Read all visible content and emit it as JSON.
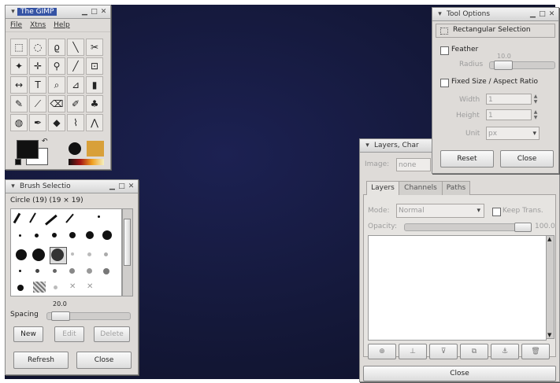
{
  "toolbox": {
    "title": "The GIMP",
    "menu": [
      "File",
      "Xtns",
      "Help"
    ],
    "tools": [
      "rect-select-icon",
      "ellipse-select-icon",
      "lasso-icon",
      "magic-wand-icon",
      "scissors-icon",
      "fuzzy-select-icon",
      "move-icon",
      "zoom-icon",
      "pencil-line-icon",
      "crop-icon",
      "flip-icon",
      "text-icon",
      "color-picker-icon",
      "bucket-fill-icon",
      "blend-icon",
      "pencil-icon",
      "paintbrush-icon",
      "eraser-icon",
      "airbrush-icon",
      "clone-icon",
      "smudge-icon",
      "dodge-icon",
      "ink-icon",
      "measure-icon",
      "path-icon"
    ],
    "tool_glyphs": [
      "⬚",
      "◌",
      "ϱ",
      "╲",
      "✂",
      "✦",
      "✛",
      "⚲",
      "╱",
      "⊡",
      "↔",
      "T",
      "⌕",
      "⊿",
      "▮",
      "✎",
      "⟋",
      "⌫",
      "✐",
      "♣",
      "◍",
      "✒",
      "◆",
      "⌇",
      "⋀"
    ]
  },
  "brush": {
    "title": "Brush Selectio",
    "brush_name": "Circle (19) (19 × 19)",
    "spacing_label": "Spacing",
    "spacing_value": "20.0",
    "new_label": "New",
    "edit_label": "Edit",
    "delete_label": "Delete",
    "refresh_label": "Refresh",
    "close_label": "Close"
  },
  "tool_options": {
    "title": "Tool Options",
    "heading": "Rectangular Selection",
    "feather_label": "Feather",
    "feather_value": "10.0",
    "radius_label": "Radius",
    "fixed_label": "Fixed Size / Aspect Ratio",
    "width_label": "Width",
    "width_value": "1",
    "height_label": "Height",
    "height_value": "1",
    "unit_label": "Unit",
    "unit_value": "px",
    "reset_label": "Reset",
    "close_label": "Close"
  },
  "layers": {
    "title": "Layers, Char",
    "image_label": "Image:",
    "image_value": "none",
    "tabs": [
      "Layers",
      "Channels",
      "Paths"
    ],
    "mode_label": "Mode:",
    "mode_value": "Normal",
    "keep_trans_label": "Keep Trans.",
    "opacity_label": "Opacity:",
    "opacity_value": "100.0",
    "close_label": "Close"
  }
}
